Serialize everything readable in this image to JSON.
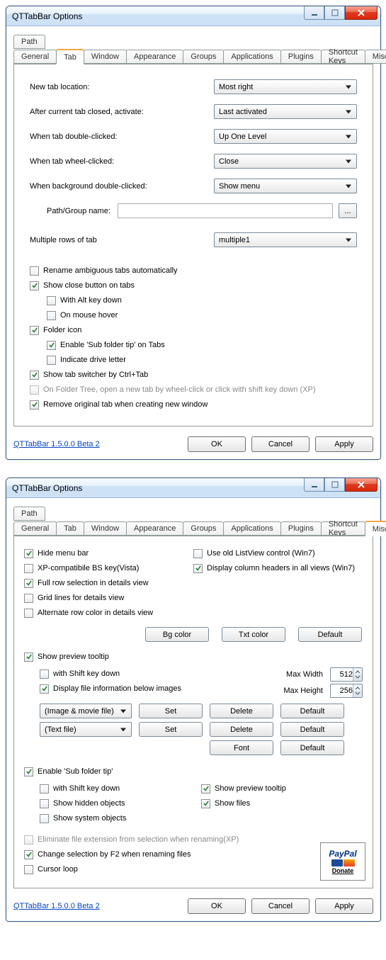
{
  "window_title": "QTTabBar Options",
  "tabs": [
    "General",
    "Tab",
    "Window",
    "Appearance",
    "Groups",
    "Applications",
    "Plugins",
    "Shortcut Keys",
    "Misc."
  ],
  "top_tab": "Path",
  "footer_link": "QTTabBar 1.5.0.0 Beta 2",
  "buttons": {
    "ok": "OK",
    "cancel": "Cancel",
    "apply": "Apply",
    "set": "Set",
    "delete": "Delete",
    "default": "Default",
    "font": "Font",
    "bgcolor": "Bg color",
    "txtcolor": "Txt color",
    "browse": "..."
  },
  "tab_page": {
    "fields": {
      "new_tab_loc": {
        "label": "New tab location:",
        "value": "Most right"
      },
      "after_close": {
        "label": "After current tab closed, activate:",
        "value": "Last activated"
      },
      "dbl_click": {
        "label": "When tab double-clicked:",
        "value": "Up One Level"
      },
      "wheel_click": {
        "label": "When tab wheel-clicked:",
        "value": "Close"
      },
      "bg_dbl": {
        "label": "When background double-clicked:",
        "value": "Show menu"
      },
      "path_group": {
        "label": "Path/Group name:",
        "value": ""
      },
      "multi_rows": {
        "label": "Multiple rows of tab",
        "value": "multiple1"
      }
    },
    "checks": {
      "rename_ambig": "Rename ambiguous tabs automatically",
      "show_close": "Show close button on tabs",
      "with_alt": "With Alt key down",
      "on_hover": "On mouse hover",
      "folder_icon": "Folder icon",
      "enable_subtip": "Enable 'Sub folder tip' on Tabs",
      "indicate_drive": "Indicate drive letter",
      "show_switcher": "Show tab switcher by Ctrl+Tab",
      "folder_tree": "On Folder Tree, open a new tab by wheel-click or click with shift key down (XP)",
      "remove_orig": "Remove original tab when creating new window"
    }
  },
  "misc_page": {
    "left": {
      "hide_menu": "Hide menu bar",
      "xp_compat": "XP-compatibile BS key(Vista)",
      "full_row": "Full row selection in details view",
      "grid_lines": "Grid lines for details view",
      "alt_row": "Alternate row color in details view"
    },
    "right": {
      "old_listview": "Use old ListView control (Win7)",
      "col_headers": "Display column headers in all views (Win7)"
    },
    "preview": {
      "show_preview": "Show preview tooltip",
      "shift_down": "with Shift key down",
      "file_info": "Display file information below images",
      "max_width_label": "Max Width",
      "max_width": "512",
      "max_height_label": "Max Height",
      "max_height": "256",
      "type_img": "(Image & movie file)",
      "type_txt": "(Text file)"
    },
    "subfolder": {
      "enable": "Enable 'Sub folder tip'",
      "shift_down": "with Shift key down",
      "hidden": "Show hidden objects",
      "system": "Show system objects",
      "preview": "Show preview tooltip",
      "files": "Show files"
    },
    "bottom": {
      "elim_ext": "Eliminate file extension from selection when renaming(XP)",
      "f2_sel": "Change selection by F2 when renaming files",
      "cursor_loop": "Cursor loop"
    },
    "donate": "Donate"
  }
}
